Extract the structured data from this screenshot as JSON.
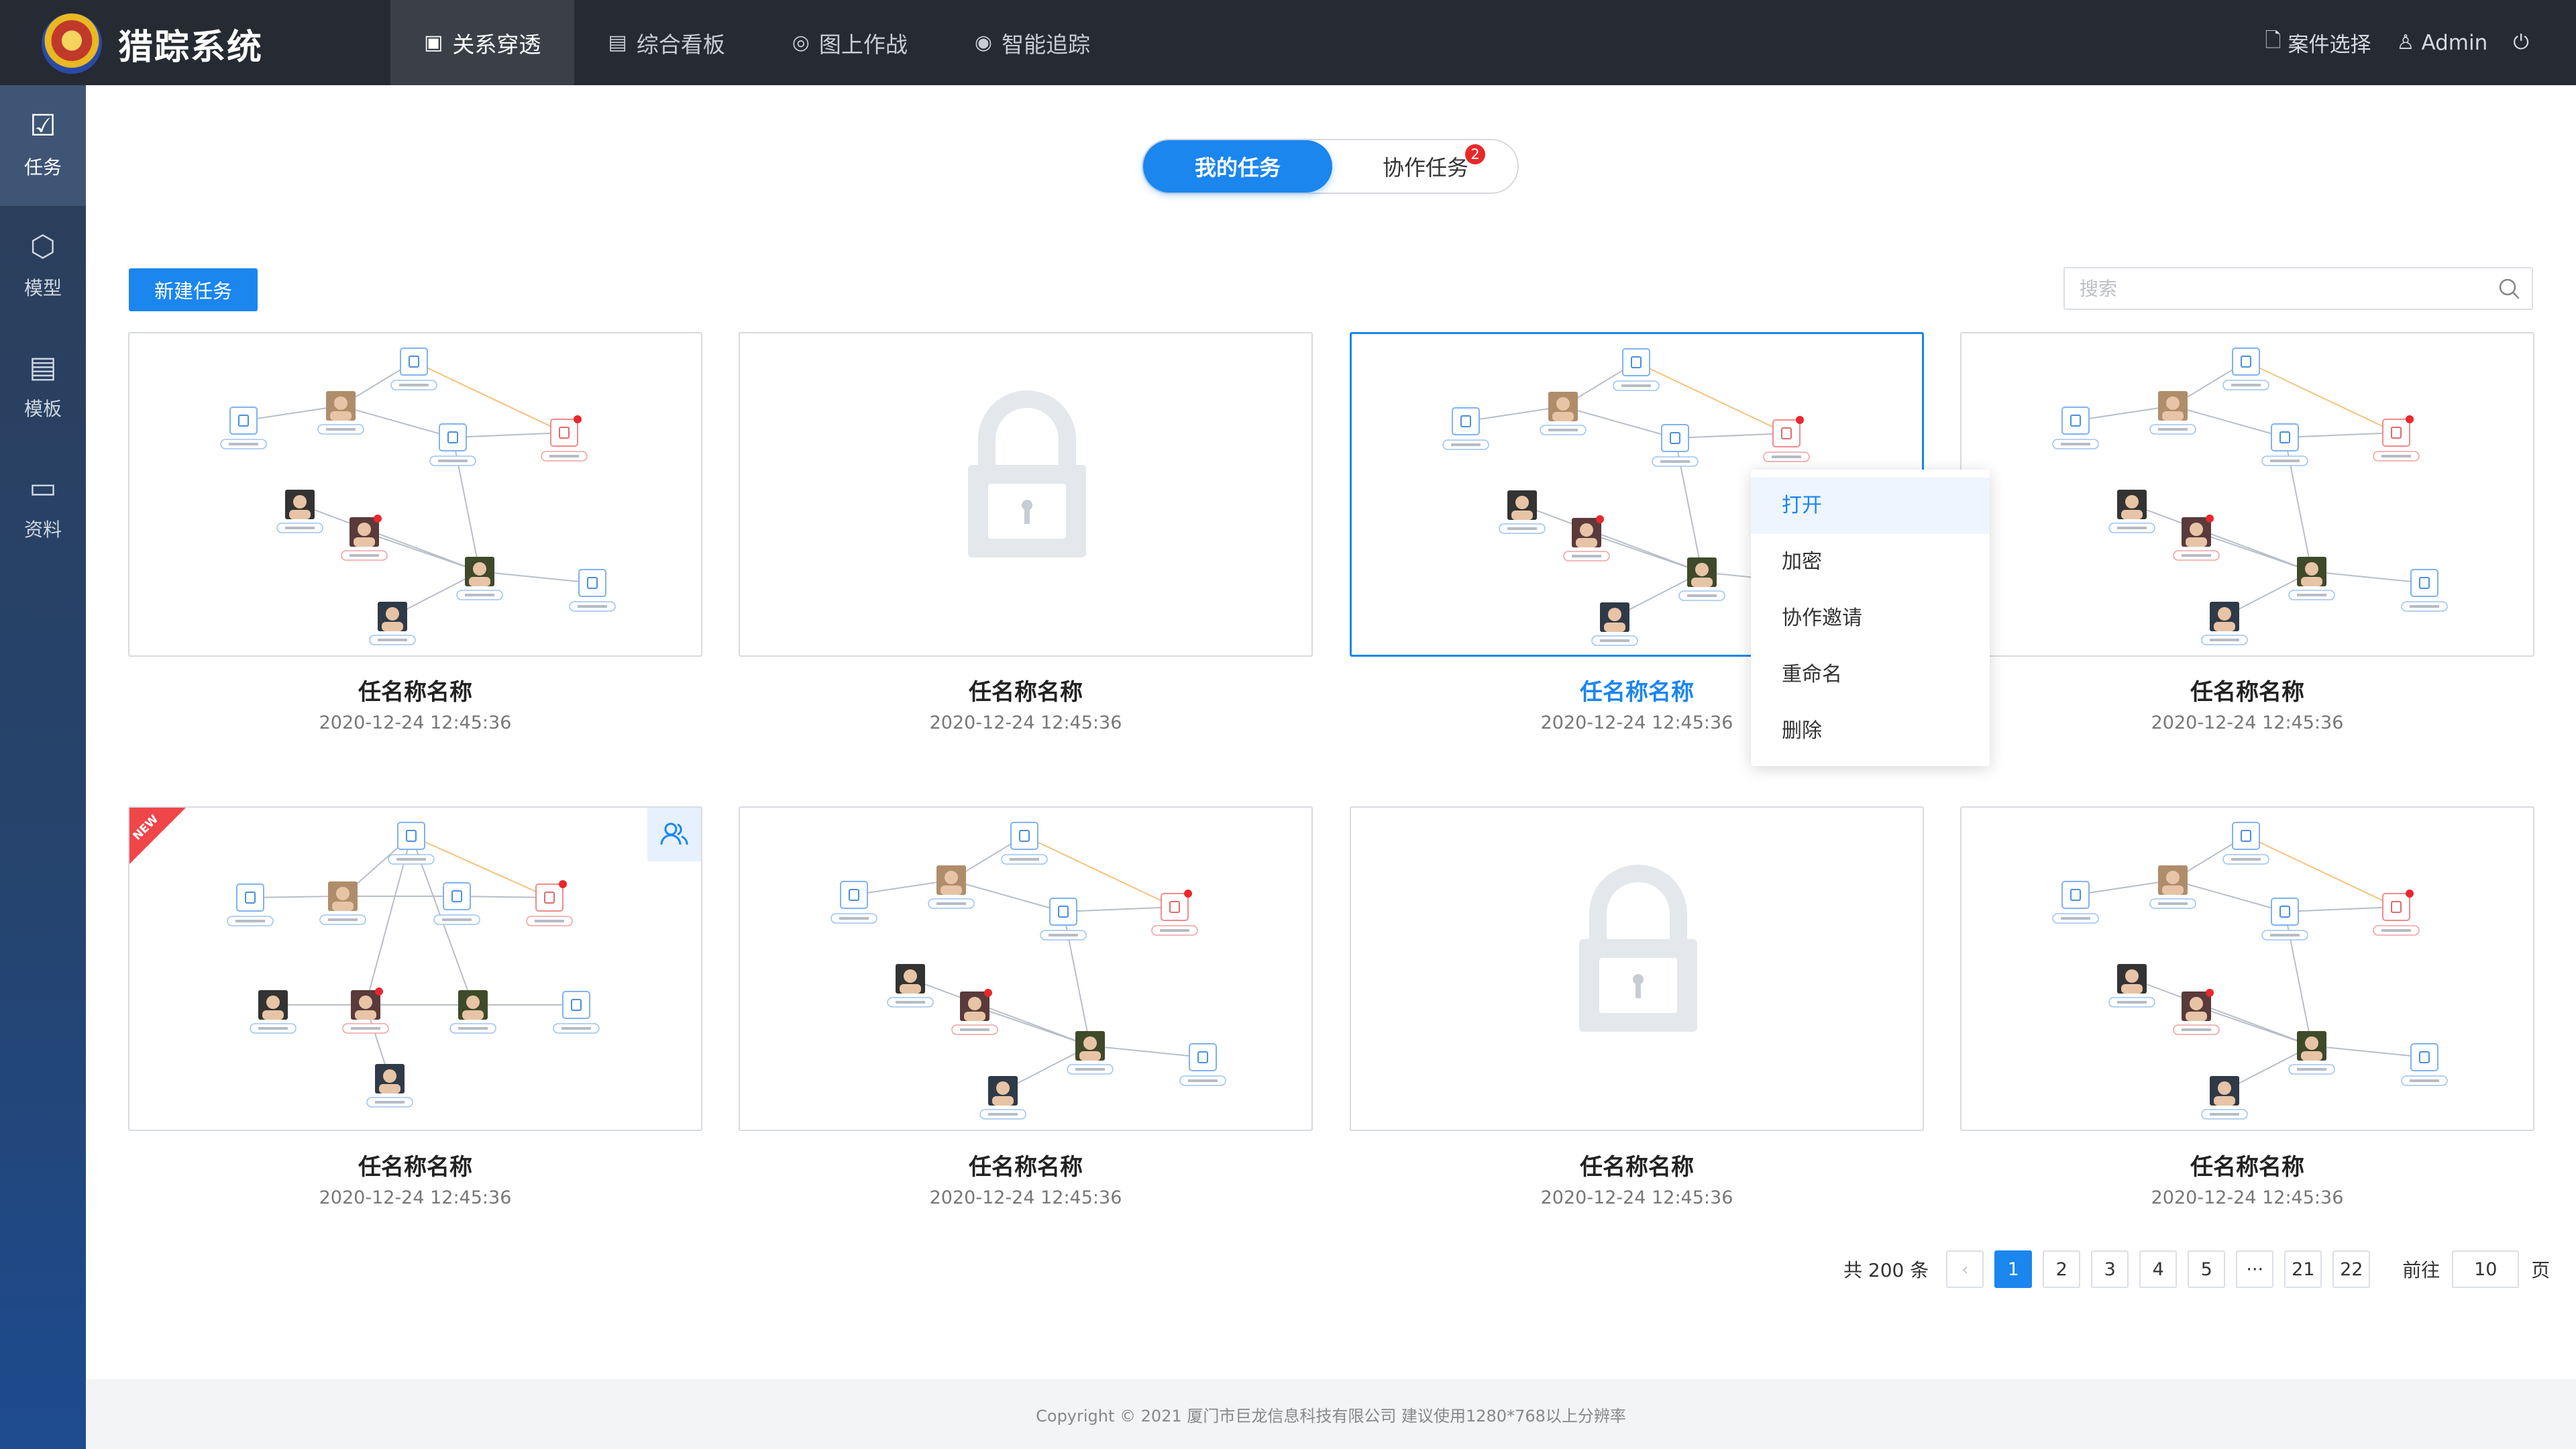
{
  "app": {
    "title": "猎踪系统"
  },
  "nav": [
    {
      "label": "关系穿透",
      "icon": "network-icon",
      "glyph": "▣",
      "active": true
    },
    {
      "label": "综合看板",
      "icon": "dashboard-icon",
      "glyph": "▤",
      "active": false
    },
    {
      "label": "图上作战",
      "icon": "map-battle-icon",
      "glyph": "◎",
      "active": false
    },
    {
      "label": "智能追踪",
      "icon": "tracking-icon",
      "glyph": "◉",
      "active": false
    }
  ],
  "header_right": {
    "case_select": "案件选择",
    "user": "Admin"
  },
  "sidebar": [
    {
      "label": "任务",
      "icon": "task-icon",
      "glyph": "☑",
      "active": true
    },
    {
      "label": "模型",
      "icon": "model-cube-icon",
      "glyph": "⬡",
      "active": false
    },
    {
      "label": "模板",
      "icon": "template-doc-icon",
      "glyph": "▤",
      "active": false
    },
    {
      "label": "资料",
      "icon": "book-icon",
      "glyph": "▭",
      "active": false
    }
  ],
  "tabs": {
    "mine": "我的任务",
    "collab": "协作任务",
    "collab_badge": "2"
  },
  "toolbar": {
    "new_task": "新建任务",
    "search_placeholder": "搜索"
  },
  "cards": [
    {
      "title": "任名称名称",
      "time": "2020-12-24  12:45:36",
      "kind": "graph"
    },
    {
      "title": "任名称名称",
      "time": "2020-12-24  12:45:36",
      "kind": "locked"
    },
    {
      "title": "任名称名称",
      "time": "2020-12-24  12:45:36",
      "kind": "graph",
      "selected": true
    },
    {
      "title": "任名称名称",
      "time": "2020-12-24  12:45:36",
      "kind": "graph"
    },
    {
      "title": "任名称名称",
      "time": "2020-12-24  12:45:36",
      "kind": "graph2",
      "new_label": "NEW",
      "collab": true
    },
    {
      "title": "任名称名称",
      "time": "2020-12-24  12:45:36",
      "kind": "graph"
    },
    {
      "title": "任名称名称",
      "time": "2020-12-24  12:45:36",
      "kind": "locked"
    },
    {
      "title": "任名称名称",
      "time": "2020-12-24  12:45:36",
      "kind": "graph"
    }
  ],
  "context_menu": [
    "打开",
    "加密",
    "协作邀请",
    "重命名",
    "删除"
  ],
  "pagination": {
    "total": "共 200 条",
    "pages": [
      "1",
      "2",
      "3",
      "4",
      "5",
      "···",
      "21",
      "22"
    ],
    "current": "1",
    "goto_label": "前往",
    "goto_value": "10",
    "page_suffix": "页"
  },
  "footer": {
    "text": "Copyright © 2021  厦门市巨龙信息科技有限公司  建议使用1280*768以上分辨率"
  }
}
